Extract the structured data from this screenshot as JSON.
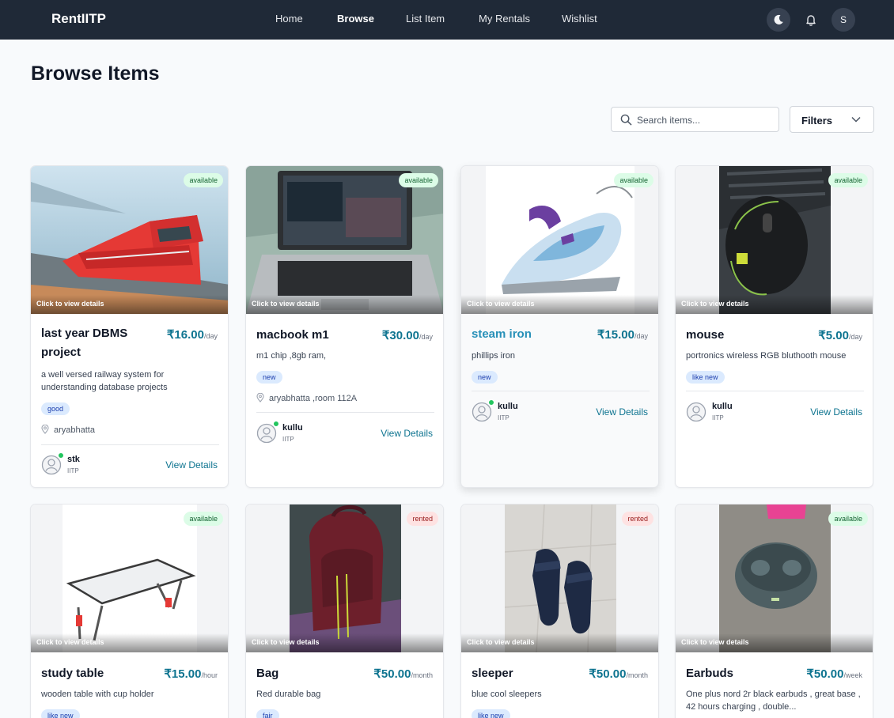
{
  "app": {
    "brand": "RentIITP",
    "user_initial": "S"
  },
  "nav": {
    "links": [
      "Home",
      "Browse",
      "List Item",
      "My Rentals",
      "Wishlist"
    ]
  },
  "page": {
    "title": "Browse Items"
  },
  "search": {
    "placeholder": "Search items..."
  },
  "filters": {
    "label": "Filters"
  },
  "image_overlay": "Click to view details",
  "view_details": "View Details",
  "items": [
    {
      "name": "last year DBMS project",
      "price": "₹16.00",
      "unit": "/day",
      "status": "available",
      "description": "a well versed railway system for understanding database projects",
      "condition": "good",
      "location": "aryabhatta",
      "owner": "stk",
      "campus": "IITP"
    },
    {
      "name": "macbook m1",
      "price": "₹30.00",
      "unit": "/day",
      "status": "available",
      "description": "m1 chip ,8gb ram,",
      "condition": "new",
      "location": "aryabhatta ,room 112A",
      "owner": "kullu",
      "campus": "IITP"
    },
    {
      "name": "steam iron",
      "price": "₹15.00",
      "unit": "/day",
      "status": "available",
      "description": "phillips iron",
      "condition": "new",
      "location": "",
      "owner": "kullu",
      "campus": "IITP"
    },
    {
      "name": "mouse",
      "price": "₹5.00",
      "unit": "/day",
      "status": "available",
      "description": "portronics wireless RGB bluthooth mouse",
      "condition": "like new",
      "location": "",
      "owner": "kullu",
      "campus": "IITP"
    },
    {
      "name": "study table",
      "price": "₹15.00",
      "unit": "/hour",
      "status": "available",
      "description": "wooden table with cup holder",
      "condition": "like new"
    },
    {
      "name": "Bag",
      "price": "₹50.00",
      "unit": "/month",
      "status": "rented",
      "description": "Red durable bag",
      "condition": "fair"
    },
    {
      "name": "sleeper",
      "price": "₹50.00",
      "unit": "/month",
      "status": "rented",
      "description": "blue cool sleepers",
      "condition": "like new"
    },
    {
      "name": "Earbuds",
      "price": "₹50.00",
      "unit": "/week",
      "status": "available",
      "description": "One plus nord 2r black earbuds , great base , 42 hours charging , double...",
      "condition": ""
    }
  ]
}
